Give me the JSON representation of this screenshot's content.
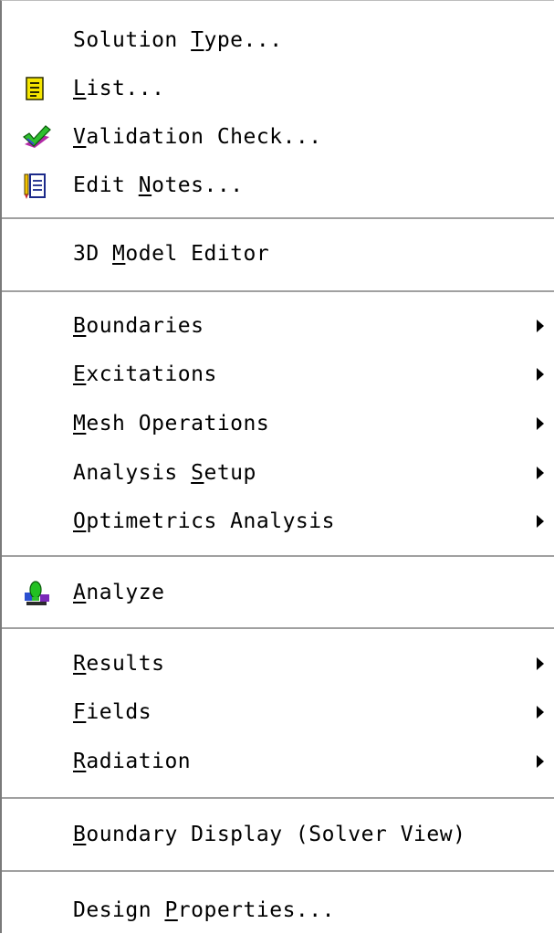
{
  "menu": {
    "items": [
      {
        "pre": "Solution ",
        "key": "T",
        "post": "ype..."
      },
      {
        "pre": "",
        "key": "L",
        "post": "ist..."
      },
      {
        "pre": "",
        "key": "V",
        "post": "alidation Check..."
      },
      {
        "pre": "Edit ",
        "key": "N",
        "post": "otes..."
      },
      {
        "pre": "3D ",
        "key": "M",
        "post": "odel Editor"
      },
      {
        "pre": "",
        "key": "B",
        "post": "oundaries"
      },
      {
        "pre": "",
        "key": "E",
        "post": "xcitations"
      },
      {
        "pre": "",
        "key": "M",
        "post": "esh Operations"
      },
      {
        "pre": "Analysis ",
        "key": "S",
        "post": "etup"
      },
      {
        "pre": "",
        "key": "O",
        "post": "ptimetrics Analysis"
      },
      {
        "pre": "",
        "key": "A",
        "post": "nalyze"
      },
      {
        "pre": "",
        "key": "R",
        "post": "esults"
      },
      {
        "pre": "",
        "key": "F",
        "post": "ields"
      },
      {
        "pre": "",
        "key": "R",
        "post": "adiation"
      },
      {
        "pre": "",
        "key": "B",
        "post": "oundary Display (Solver View)"
      },
      {
        "pre": "Design ",
        "key": "P",
        "post": "roperties..."
      }
    ],
    "icons": {
      "list": "list-document-icon",
      "validation": "validation-check-icon",
      "notes": "edit-notes-icon",
      "analyze": "analyze-icon"
    },
    "submenu_indicator": "submenu-arrow-icon"
  }
}
